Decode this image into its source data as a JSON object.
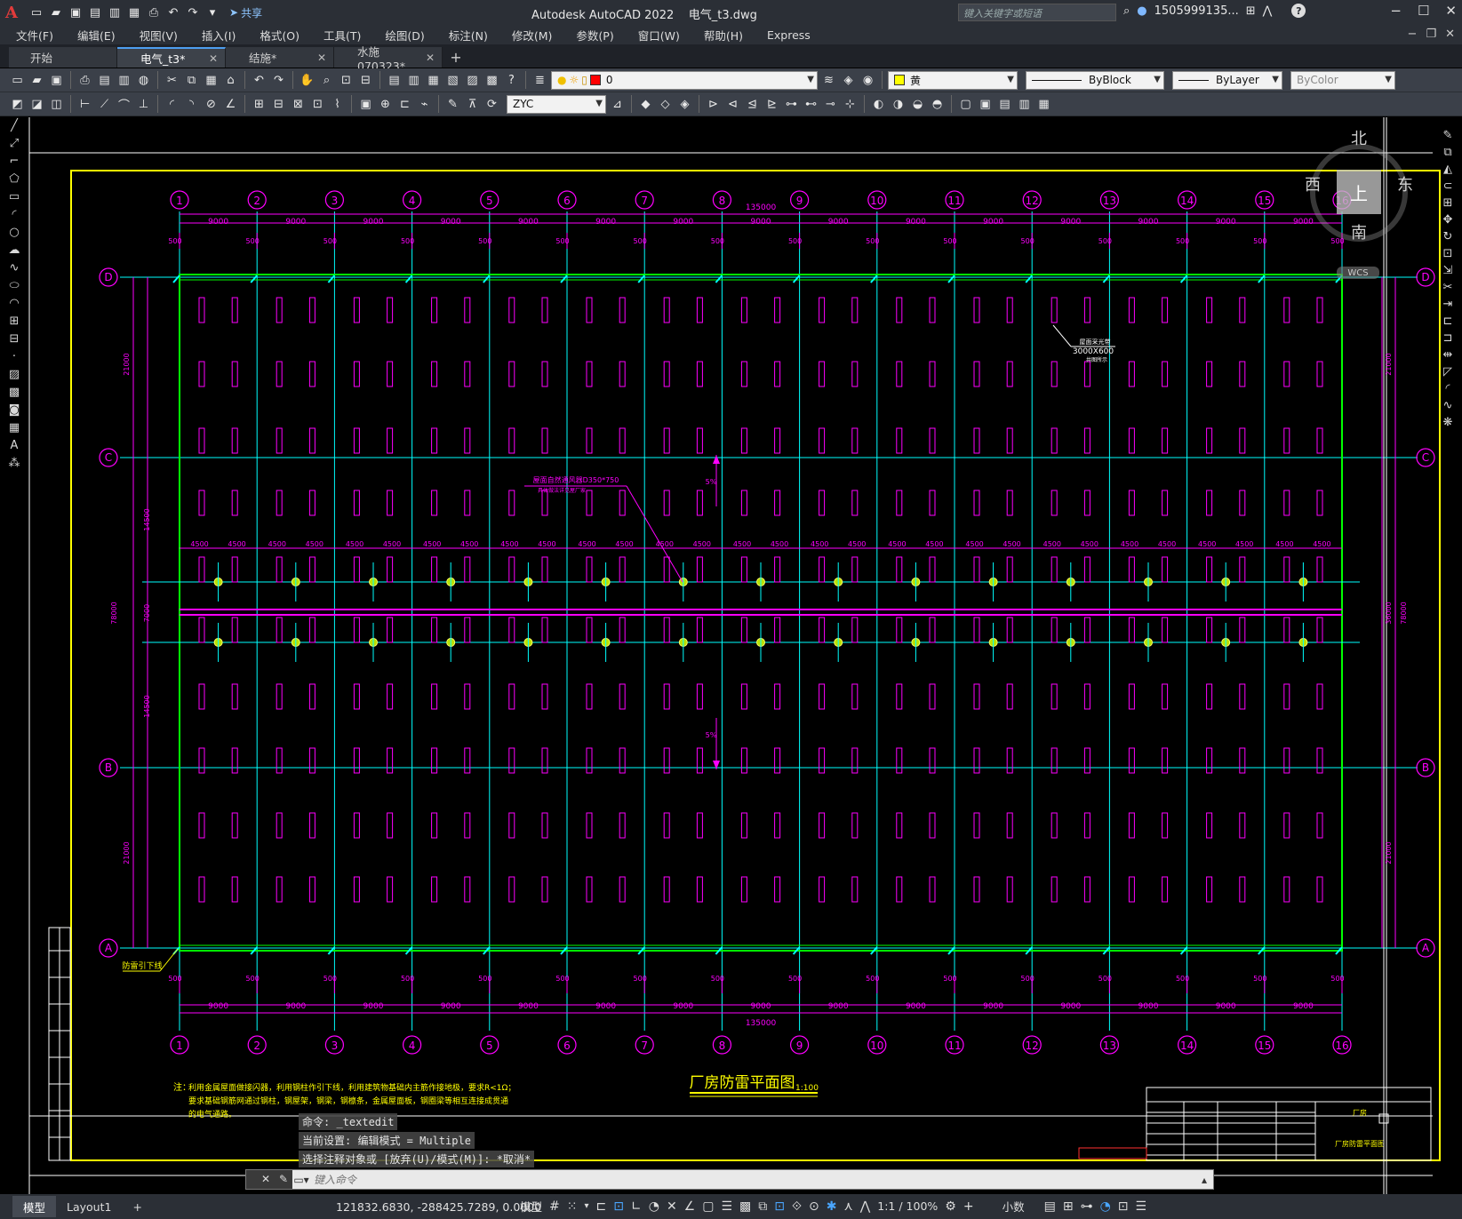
{
  "app": {
    "logo": "A",
    "title": "Autodesk AutoCAD 2022",
    "filename": "电气_t3.dwg",
    "share_label": "共享",
    "search_placeholder": "键入关键字或短语",
    "user": "1505999135...",
    "help_icon": "?"
  },
  "menu": [
    "文件(F)",
    "编辑(E)",
    "视图(V)",
    "插入(I)",
    "格式(O)",
    "工具(T)",
    "绘图(D)",
    "标注(N)",
    "修改(M)",
    "参数(P)",
    "窗口(W)",
    "帮助(H)",
    "Express"
  ],
  "tabs": [
    {
      "label": "开始",
      "closable": false,
      "active": false
    },
    {
      "label": "电气_t3*",
      "closable": true,
      "active": true
    },
    {
      "label": "结施*",
      "closable": true,
      "active": false
    },
    {
      "label": "水施070323*",
      "closable": true,
      "active": false
    }
  ],
  "toolbar": {
    "layer_value": "0",
    "color_value": "黄",
    "linetype_value": "ByBlock",
    "lineweight_value": "ByLayer",
    "plotstyle_value": "ByColor",
    "textstyle_value": "ZYC"
  },
  "viewcube": {
    "north": "北",
    "south": "南",
    "east": "东",
    "west": "西",
    "face": "上",
    "wcs": "WCS"
  },
  "drawing": {
    "title": "厂房防雷平面图",
    "scale": "1:100",
    "total_dim": "135000",
    "bay_dim": "9000",
    "half_bay_dim": "4500",
    "offset_dim": "500",
    "col_labels": [
      "1",
      "2",
      "3",
      "4",
      "5",
      "6",
      "7",
      "8",
      "9",
      "10",
      "11",
      "12",
      "13",
      "14",
      "15",
      "16"
    ],
    "row_labels": [
      "D",
      "C",
      "B",
      "A"
    ],
    "left_dims": [
      "21000",
      "14500",
      "7000",
      "14500",
      "21000"
    ],
    "left_total": "78000",
    "right_dims": [
      "21000",
      "36000",
      "21000"
    ],
    "right_total": "78000",
    "down_conductor_label": "防雷引下线",
    "note_prefix": "注：",
    "note_lines": [
      "利用金属屋面做接闪器，利用钢柱作引下线，利用建筑物基础内主筋作接地极，要求R<1Ω；",
      "要求基础钢筋网通过钢柱，钢屋架，钢梁，钢檩条，金属屋面板，钢圈梁等相互连接成贯通",
      "的电气通路。"
    ],
    "skylight_callout": [
      "屋面采光带",
      "3000X600",
      "共图所示"
    ],
    "vent_callout": [
      "屋面自然通风器D350*750",
      "具体做法详见屋厂家"
    ],
    "titleblock_project": "厂房",
    "titleblock_drawing": "厂房防雷平面图",
    "slope_label": "5%",
    "colors": {
      "yellow": "#ffff00",
      "magenta": "#ff00ff",
      "cyan": "#00ffff",
      "green": "#00ff00",
      "white": "#ffffff"
    }
  },
  "command": {
    "history": [
      "命令: _textedit",
      "当前设置: 编辑模式 = Multiple",
      "选择注释对象或 [放弃(U)/模式(M)]: *取消*"
    ],
    "placeholder": "键入命令"
  },
  "status": {
    "tabs": [
      "模型",
      "Layout1"
    ],
    "coords": "121832.6830, -288425.7289, 0.0000",
    "model_label": "模型",
    "scale": "1:1 / 100%",
    "units": "小数"
  }
}
